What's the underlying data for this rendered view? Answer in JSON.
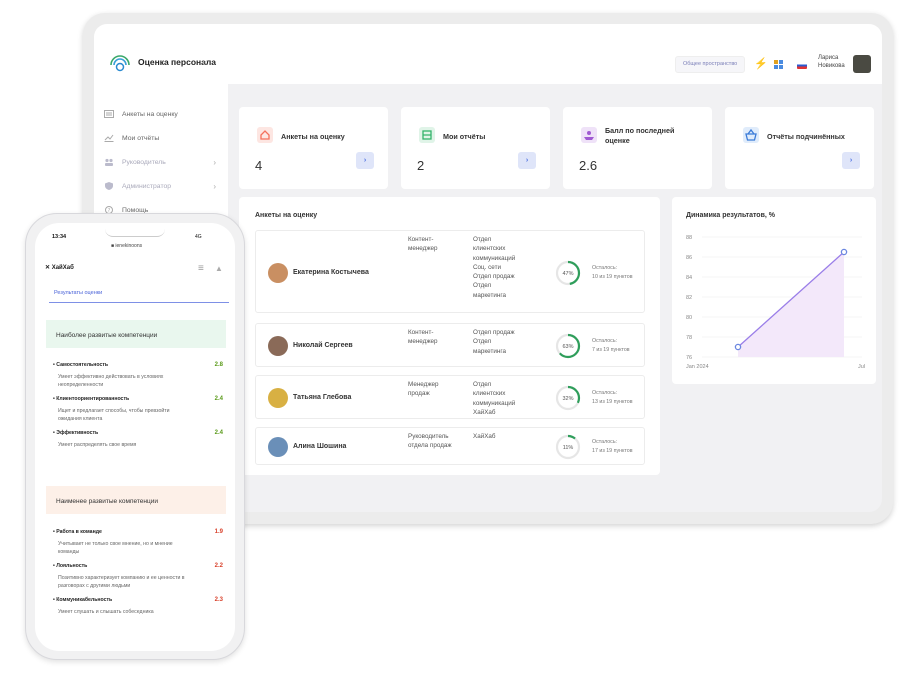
{
  "app": {
    "title": "Оценка персонала"
  },
  "sidebar": {
    "items": [
      {
        "label": "Анкеты на оценку",
        "icon": "list-icon"
      },
      {
        "label": "Мои отчёты",
        "icon": "chart-icon"
      },
      {
        "label": "Руководитель",
        "icon": "users-icon"
      },
      {
        "label": "Администратор",
        "icon": "shield-icon"
      },
      {
        "label": "Помощь",
        "icon": "help-icon"
      }
    ]
  },
  "header": {
    "workspace_button": "Общее пространство",
    "user_name_line1": "Лариса",
    "user_name_line2": "Новикова"
  },
  "stats": [
    {
      "title": "Анкеты на оценку",
      "value": "4",
      "color": "#f4705c"
    },
    {
      "title": "Мои отчёты",
      "value": "2",
      "color": "#33b36b"
    },
    {
      "title_line1": "Балл по последней",
      "title_line2": "оценке",
      "value": "2.6",
      "color": "#a05ad2"
    },
    {
      "title": "Отчёты подчинённых",
      "value": "",
      "color": "#3b7bd8"
    }
  ],
  "surveys": {
    "title": "Анкеты на оценку",
    "rows": [
      {
        "name": "Екатерина Костычева",
        "position": [
          "Контент-",
          "менеджер"
        ],
        "department": [
          "Отдел",
          "клиентских",
          "коммуникаций",
          "Соц. сети",
          "Отдел продаж",
          "Отдел",
          "маркетинга"
        ],
        "percent": 47,
        "progress_label": "47%",
        "remaining_line1": "Осталось:",
        "remaining_line2": "10 из 19 пунктов"
      },
      {
        "name": "Николай Сергеев",
        "position": [
          "Контент-",
          "менеджер"
        ],
        "department": [
          "Отдел продаж",
          "Отдел",
          "маркетинга"
        ],
        "percent": 63,
        "progress_label": "63%",
        "remaining_line1": "Осталось:",
        "remaining_line2": "7 из 19 пунктов"
      },
      {
        "name": "Татьяна Глебова",
        "position": [
          "Менеджер",
          "продаж"
        ],
        "department": [
          "Отдел",
          "клиентских",
          "коммуникаций",
          "ХайХаб"
        ],
        "percent": 32,
        "progress_label": "32%",
        "remaining_line1": "Осталось:",
        "remaining_line2": "13 из 19 пунктов"
      },
      {
        "name": "Алина Шошина",
        "position": [
          "Руководитель",
          "отдела продаж"
        ],
        "department": [
          "ХайХаб"
        ],
        "percent": 11,
        "progress_label": "11%",
        "remaining_line1": "Осталось:",
        "remaining_line2": "17 из 19 пунктов"
      }
    ]
  },
  "chart_data": {
    "type": "line",
    "title": "Динамика результатов, %",
    "x": [
      "Jan 2024",
      "Jul"
    ],
    "values": [
      77,
      86.5
    ],
    "ylim": [
      76,
      88
    ],
    "yticks": [
      "88",
      "86",
      "84",
      "82",
      "80",
      "78",
      "76"
    ],
    "xtick_labels": [
      "Jan 2024",
      "Jul"
    ],
    "grid": true
  },
  "mobile": {
    "time": "13:34",
    "status": "4G",
    "url": "■ ienekinoons",
    "brand": "ХайХаб",
    "tab": "Результаты оценки",
    "best": {
      "title": "Наиболее развитые компетенции",
      "items": [
        {
          "name": "Самостоятельность",
          "score": "2.8",
          "desc": [
            "Умеет эффективно действовать в условиях",
            "неопределенности"
          ]
        },
        {
          "name": "Клиентоориентированность",
          "score": "2.4",
          "desc": [
            "Ищет и предлагает способы, чтобы превзойти",
            "ожидания клиента"
          ]
        },
        {
          "name": "Эффективность",
          "score": "2.4",
          "desc": [
            "Умеет распределять свое время"
          ]
        }
      ]
    },
    "worst": {
      "title": "Наименее развитые компетенции",
      "items": [
        {
          "name": "Работа в команде",
          "score": "1.9",
          "desc": [
            "Учитывает не только свое мнение, но и мнение",
            "команды"
          ]
        },
        {
          "name": "Лояльность",
          "score": "2.2",
          "desc": [
            "Позитивно характеризует компанию и ее ценности в",
            "разговорах с другими людьми"
          ]
        },
        {
          "name": "Коммуникабельность",
          "score": "2.3",
          "desc": [
            "Умеет слушать и слышать собеседника"
          ]
        }
      ]
    }
  }
}
